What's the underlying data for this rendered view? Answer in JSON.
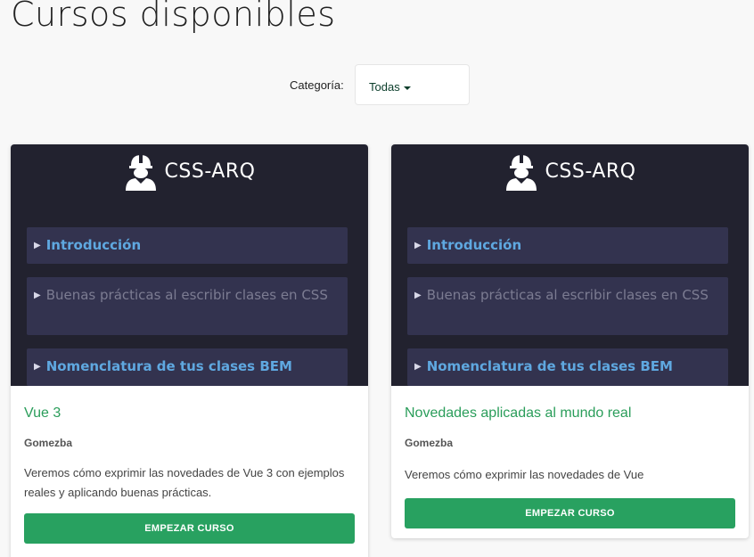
{
  "page": {
    "title": "Cursos disponibles"
  },
  "filter": {
    "label": "Categoría:",
    "selected": "Todas"
  },
  "courses": [
    {
      "thumbnail": {
        "brand": "CSS-ARQ",
        "lessons": [
          "Introducción",
          "Buenas prácticas al escribir clases en CSS",
          "Nomenclatura de tus clases BEM"
        ]
      },
      "title": "Vue 3",
      "author": "Gomezba",
      "description": "Veremos cómo exprimir las novedades de Vue 3 con ejemplos reales y aplicando buenas prácticas.",
      "button": "EMPEZAR CURSO"
    },
    {
      "thumbnail": {
        "brand": "CSS-ARQ",
        "lessons": [
          "Introducción",
          "Buenas prácticas al escribir clases en CSS",
          "Nomenclatura de tus clases BEM"
        ]
      },
      "title": "Novedades aplicadas al mundo real",
      "author": "Gomezba",
      "description": "Veremos cómo exprimir las novedades de Vue",
      "button": "EMPEZAR CURSO"
    }
  ],
  "colors": {
    "accent": "#28a160",
    "title_green": "#2a9d5a",
    "thumb_bg": "#22222f",
    "lesson_bg": "#33334f",
    "lesson_link": "#5fa8e0"
  },
  "icons": {
    "brand_logo": "worker-helmet-icon",
    "expand": "triangle-right-icon",
    "dropdown": "caret-down-icon"
  }
}
